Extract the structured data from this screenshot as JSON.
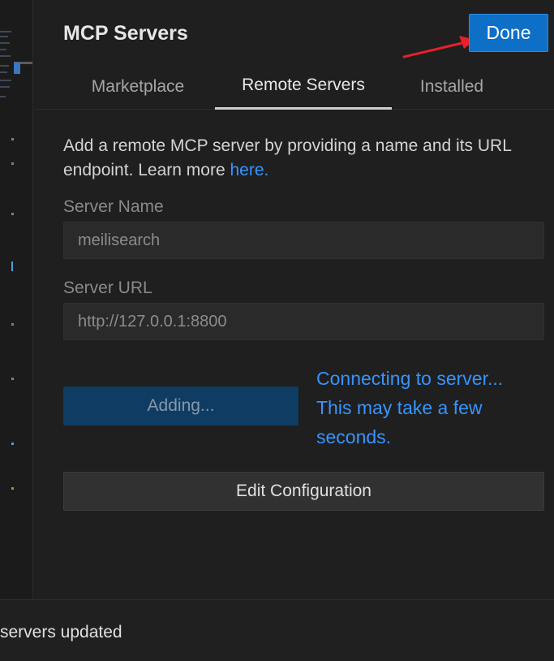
{
  "panel": {
    "title": "MCP Servers",
    "done_label": "Done",
    "tabs": [
      {
        "label": "Marketplace",
        "active": false
      },
      {
        "label": "Remote Servers",
        "active": true
      },
      {
        "label": "Installed",
        "active": false
      }
    ]
  },
  "form": {
    "description_text": "Add a remote MCP server by providing a name and its URL endpoint. Learn more ",
    "learn_more_link": "here.",
    "server_name_label": "Server Name",
    "server_name_value": "meilisearch",
    "server_url_label": "Server URL",
    "server_url_value": "http://127.0.0.1:8800",
    "adding_label": "Adding...",
    "status_lines": [
      "Connecting to server...",
      "This may take a few",
      "seconds."
    ],
    "edit_config_label": "Edit Configuration"
  },
  "statusbar": {
    "message": "servers updated"
  },
  "colors": {
    "accent": "#0e6fc7",
    "link": "#3794ff",
    "annotation_arrow": "#e8202a"
  }
}
